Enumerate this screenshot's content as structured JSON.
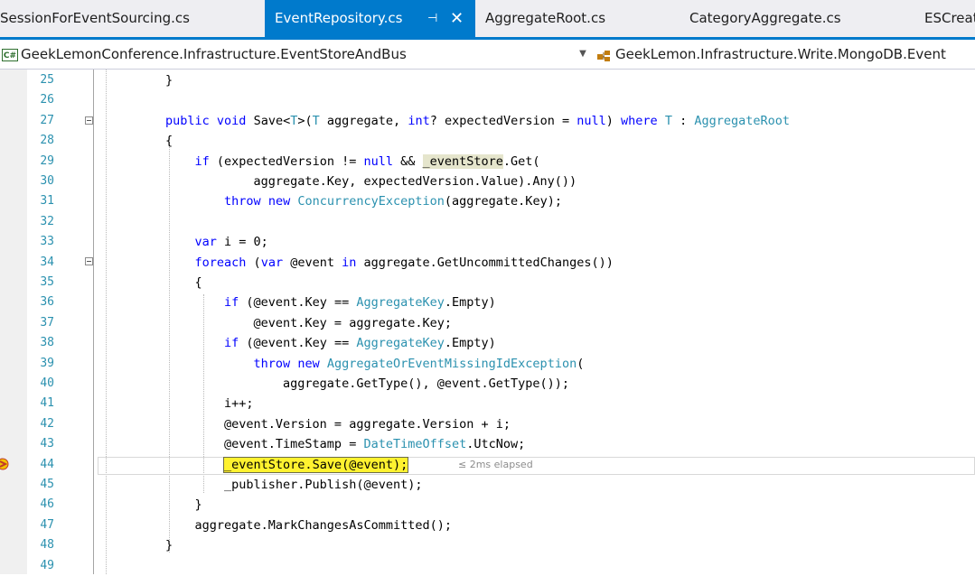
{
  "tabs": [
    {
      "label": "SessionForEventSourcing.cs",
      "active": false
    },
    {
      "label": "EventRepository.cs",
      "active": true
    },
    {
      "label": "AggregateRoot.cs",
      "active": false
    },
    {
      "label": "CategoryAggregate.cs",
      "active": false
    },
    {
      "label": "ESCreat",
      "active": false
    }
  ],
  "tab_pin_icon": "pin-icon",
  "tab_close_icon": "close-icon",
  "nav": {
    "project_badge": "C#",
    "namespace": "GeekLemonConference.Infrastructure.EventStoreAndBus",
    "class_path": "GeekLemon.Infrastructure.Write.MongoDB.Event"
  },
  "editor": {
    "current_line": "44",
    "elapsed": "≤ 2ms elapsed",
    "lines": [
      {
        "n": "25",
        "parts": [
          {
            "t": "}",
            "c": ""
          }
        ]
      },
      {
        "n": "26",
        "parts": []
      },
      {
        "n": "27",
        "parts": [
          {
            "t": "public",
            "c": "kw"
          },
          {
            "t": " ",
            "c": ""
          },
          {
            "t": "void",
            "c": "kw"
          },
          {
            "t": " Save<",
            "c": ""
          },
          {
            "t": "T",
            "c": "ty"
          },
          {
            "t": ">(",
            "c": ""
          },
          {
            "t": "T",
            "c": "ty"
          },
          {
            "t": " aggregate, ",
            "c": ""
          },
          {
            "t": "int",
            "c": "kw"
          },
          {
            "t": "? expectedVersion = ",
            "c": ""
          },
          {
            "t": "null",
            "c": "kw"
          },
          {
            "t": ") ",
            "c": ""
          },
          {
            "t": "where",
            "c": "kw"
          },
          {
            "t": " ",
            "c": ""
          },
          {
            "t": "T",
            "c": "ty"
          },
          {
            "t": " : ",
            "c": ""
          },
          {
            "t": "AggregateRoot",
            "c": "ty"
          }
        ]
      },
      {
        "n": "28",
        "parts": [
          {
            "t": "{",
            "c": ""
          }
        ]
      },
      {
        "n": "29",
        "parts": [
          {
            "t": "    ",
            "c": ""
          },
          {
            "t": "if",
            "c": "kw"
          },
          {
            "t": " (expectedVersion != ",
            "c": ""
          },
          {
            "t": "null",
            "c": "kw"
          },
          {
            "t": " && ",
            "c": ""
          },
          {
            "t": "_eventStore",
            "c": "hl-ref"
          },
          {
            "t": ".Get(",
            "c": ""
          }
        ]
      },
      {
        "n": "30",
        "parts": [
          {
            "t": "            aggregate.Key, expectedVersion.Value).Any())",
            "c": ""
          }
        ]
      },
      {
        "n": "31",
        "parts": [
          {
            "t": "        ",
            "c": ""
          },
          {
            "t": "throw",
            "c": "kw"
          },
          {
            "t": " ",
            "c": ""
          },
          {
            "t": "new",
            "c": "kw"
          },
          {
            "t": " ",
            "c": ""
          },
          {
            "t": "ConcurrencyException",
            "c": "ty"
          },
          {
            "t": "(aggregate.Key);",
            "c": ""
          }
        ]
      },
      {
        "n": "32",
        "parts": []
      },
      {
        "n": "33",
        "parts": [
          {
            "t": "    ",
            "c": ""
          },
          {
            "t": "var",
            "c": "kw"
          },
          {
            "t": " i = 0;",
            "c": ""
          }
        ]
      },
      {
        "n": "34",
        "parts": [
          {
            "t": "    ",
            "c": ""
          },
          {
            "t": "foreach",
            "c": "kw"
          },
          {
            "t": " (",
            "c": ""
          },
          {
            "t": "var",
            "c": "kw"
          },
          {
            "t": " @event ",
            "c": ""
          },
          {
            "t": "in",
            "c": "kw"
          },
          {
            "t": " aggregate.GetUncommittedChanges())",
            "c": ""
          }
        ]
      },
      {
        "n": "35",
        "parts": [
          {
            "t": "    {",
            "c": ""
          }
        ]
      },
      {
        "n": "36",
        "parts": [
          {
            "t": "        ",
            "c": ""
          },
          {
            "t": "if",
            "c": "kw"
          },
          {
            "t": " (@event.Key == ",
            "c": ""
          },
          {
            "t": "AggregateKey",
            "c": "ty"
          },
          {
            "t": ".Empty)",
            "c": ""
          }
        ]
      },
      {
        "n": "37",
        "parts": [
          {
            "t": "            @event.Key = aggregate.Key;",
            "c": ""
          }
        ]
      },
      {
        "n": "38",
        "parts": [
          {
            "t": "        ",
            "c": ""
          },
          {
            "t": "if",
            "c": "kw"
          },
          {
            "t": " (@event.Key == ",
            "c": ""
          },
          {
            "t": "AggregateKey",
            "c": "ty"
          },
          {
            "t": ".Empty)",
            "c": ""
          }
        ]
      },
      {
        "n": "39",
        "parts": [
          {
            "t": "            ",
            "c": ""
          },
          {
            "t": "throw",
            "c": "kw"
          },
          {
            "t": " ",
            "c": ""
          },
          {
            "t": "new",
            "c": "kw"
          },
          {
            "t": " ",
            "c": ""
          },
          {
            "t": "AggregateOrEventMissingIdException",
            "c": "ty"
          },
          {
            "t": "(",
            "c": ""
          }
        ]
      },
      {
        "n": "40",
        "parts": [
          {
            "t": "                aggregate.GetType(), @event.GetType());",
            "c": ""
          }
        ]
      },
      {
        "n": "41",
        "parts": [
          {
            "t": "        i++;",
            "c": ""
          }
        ]
      },
      {
        "n": "42",
        "parts": [
          {
            "t": "        @event.Version = aggregate.Version + i;",
            "c": ""
          }
        ]
      },
      {
        "n": "43",
        "parts": [
          {
            "t": "        @event.TimeStamp = ",
            "c": ""
          },
          {
            "t": "DateTimeOffset",
            "c": "ty"
          },
          {
            "t": ".UtcNow;",
            "c": ""
          }
        ]
      },
      {
        "n": "44",
        "parts": [
          {
            "t": "        ",
            "c": ""
          },
          {
            "t": "_eventStore.Save(@event);",
            "c": "hl-exec"
          }
        ]
      },
      {
        "n": "45",
        "parts": [
          {
            "t": "        _publisher.Publish(@event);",
            "c": ""
          }
        ]
      },
      {
        "n": "46",
        "parts": [
          {
            "t": "    }",
            "c": ""
          }
        ]
      },
      {
        "n": "47",
        "parts": [
          {
            "t": "    aggregate.MarkChangesAsCommitted();",
            "c": ""
          }
        ]
      },
      {
        "n": "48",
        "parts": [
          {
            "t": "}",
            "c": ""
          }
        ]
      },
      {
        "n": "49",
        "parts": []
      }
    ]
  },
  "colors": {
    "accent": "#007acc",
    "keyword": "#0000ff",
    "type": "#2b91af",
    "exec_highlight": "#fff230"
  }
}
